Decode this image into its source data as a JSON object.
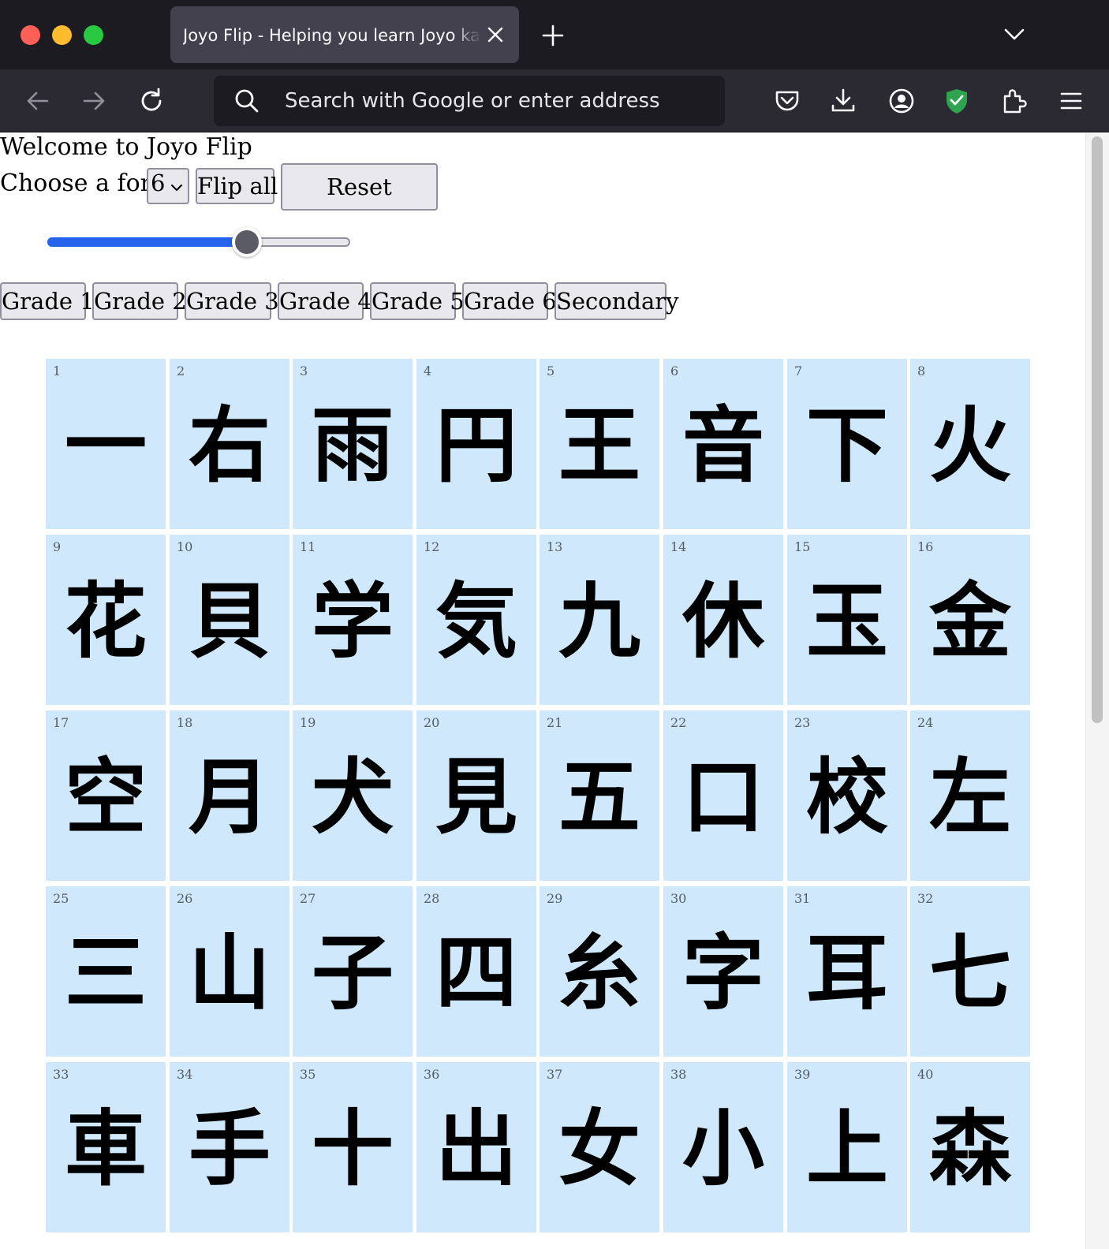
{
  "browser": {
    "tab_title": "Joyo Flip - Helping you learn Joyo kanji",
    "address_placeholder": "Search with Google or enter address"
  },
  "page": {
    "welcome": "Welcome to Joyo Flip",
    "font_label": "Choose a font",
    "font_selected": "6",
    "flip_all": "Flip all",
    "reset": "Reset",
    "slider_value_fraction": 0.66,
    "grades": [
      "Grade 1",
      "Grade 2",
      "Grade 3",
      "Grade 4",
      "Grade 5",
      "Grade 6",
      "Secondary"
    ]
  },
  "cards": [
    {
      "n": "1",
      "k": "一"
    },
    {
      "n": "2",
      "k": "右"
    },
    {
      "n": "3",
      "k": "雨"
    },
    {
      "n": "4",
      "k": "円"
    },
    {
      "n": "5",
      "k": "王"
    },
    {
      "n": "6",
      "k": "音"
    },
    {
      "n": "7",
      "k": "下"
    },
    {
      "n": "8",
      "k": "火"
    },
    {
      "n": "9",
      "k": "花"
    },
    {
      "n": "10",
      "k": "貝"
    },
    {
      "n": "11",
      "k": "学"
    },
    {
      "n": "12",
      "k": "気"
    },
    {
      "n": "13",
      "k": "九"
    },
    {
      "n": "14",
      "k": "休"
    },
    {
      "n": "15",
      "k": "玉"
    },
    {
      "n": "16",
      "k": "金"
    },
    {
      "n": "17",
      "k": "空"
    },
    {
      "n": "18",
      "k": "月"
    },
    {
      "n": "19",
      "k": "犬"
    },
    {
      "n": "20",
      "k": "見"
    },
    {
      "n": "21",
      "k": "五"
    },
    {
      "n": "22",
      "k": "口"
    },
    {
      "n": "23",
      "k": "校"
    },
    {
      "n": "24",
      "k": "左"
    },
    {
      "n": "25",
      "k": "三"
    },
    {
      "n": "26",
      "k": "山"
    },
    {
      "n": "27",
      "k": "子"
    },
    {
      "n": "28",
      "k": "四"
    },
    {
      "n": "29",
      "k": "糸"
    },
    {
      "n": "30",
      "k": "字"
    },
    {
      "n": "31",
      "k": "耳"
    },
    {
      "n": "32",
      "k": "七"
    },
    {
      "n": "33",
      "k": "車"
    },
    {
      "n": "34",
      "k": "手"
    },
    {
      "n": "35",
      "k": "十"
    },
    {
      "n": "36",
      "k": "出"
    },
    {
      "n": "37",
      "k": "女"
    },
    {
      "n": "38",
      "k": "小"
    },
    {
      "n": "39",
      "k": "上"
    },
    {
      "n": "40",
      "k": "森"
    }
  ],
  "colors": {
    "card_bg": "#cfe8fb",
    "slider_fill": "#2463eb",
    "shield": "#2ea44f"
  },
  "icons": [
    "back-icon",
    "forward-icon",
    "reload-icon",
    "search-icon",
    "pocket-icon",
    "download-icon",
    "account-icon",
    "shield-extension-icon",
    "extensions-icon",
    "menu-icon",
    "close-icon",
    "plus-icon",
    "chevron-down-icon"
  ]
}
